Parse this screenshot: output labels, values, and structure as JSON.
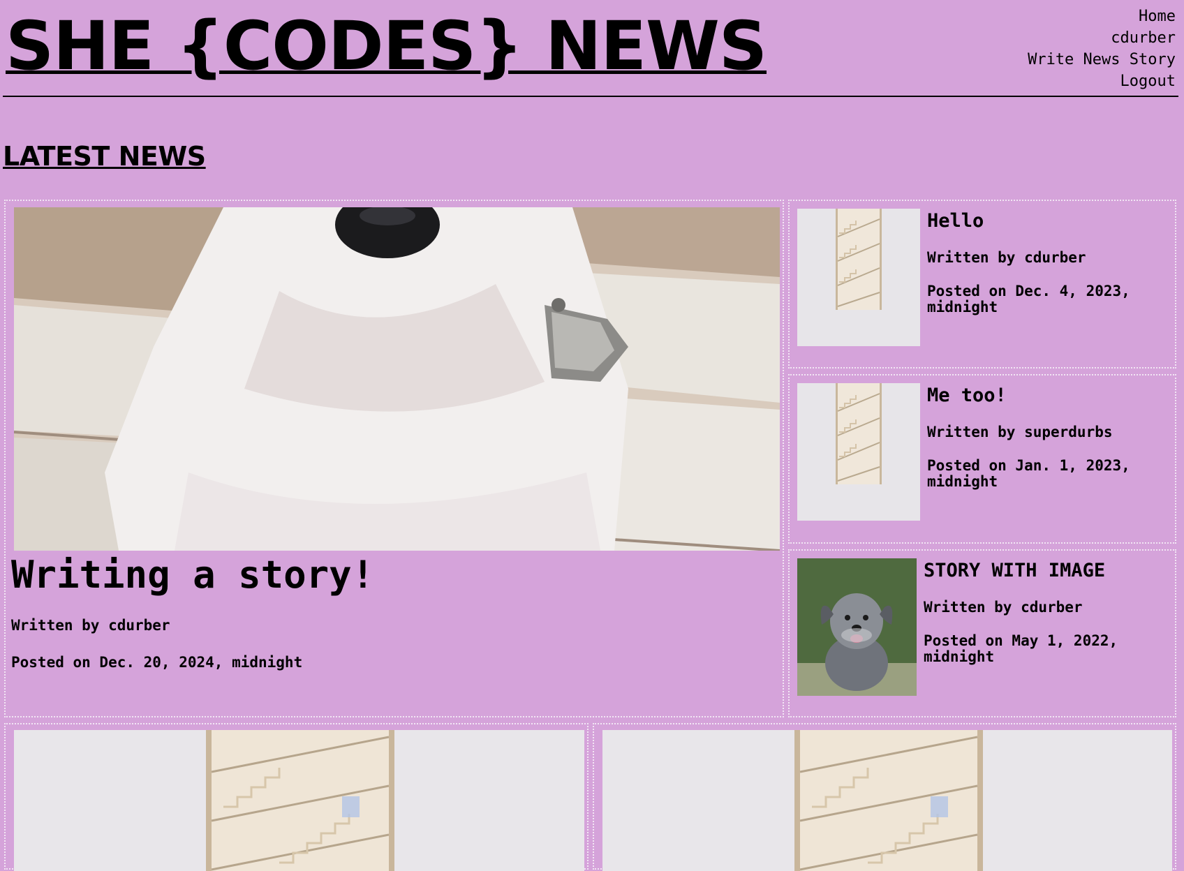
{
  "site": {
    "title": "SHE {CODES} NEWS"
  },
  "nav": {
    "items": [
      "Home",
      "cdurber",
      "Write News Story",
      "Logout"
    ]
  },
  "section": {
    "title": "LATEST NEWS"
  },
  "featured": {
    "title": "Writing a story!",
    "author": "Written by cdurber",
    "posted": "Posted on Dec. 20, 2024, midnight",
    "image": "white-dog-with-bell"
  },
  "side_stories": [
    {
      "title": "Hello",
      "author": "Written by cdurber",
      "posted": "Posted on Dec. 4, 2023, midnight",
      "image": "staircase"
    },
    {
      "title": "Me too!",
      "author": "Written by superdurbs",
      "posted": "Posted on Jan. 1, 2023, midnight",
      "image": "staircase"
    },
    {
      "title": "STORY WITH IMAGE",
      "author": "Written by cdurber",
      "posted": "Posted on May 1, 2022, midnight",
      "image": "schnauzer-puppy"
    }
  ],
  "bottom_stories": [
    {
      "image": "staircase"
    },
    {
      "image": "staircase"
    }
  ]
}
